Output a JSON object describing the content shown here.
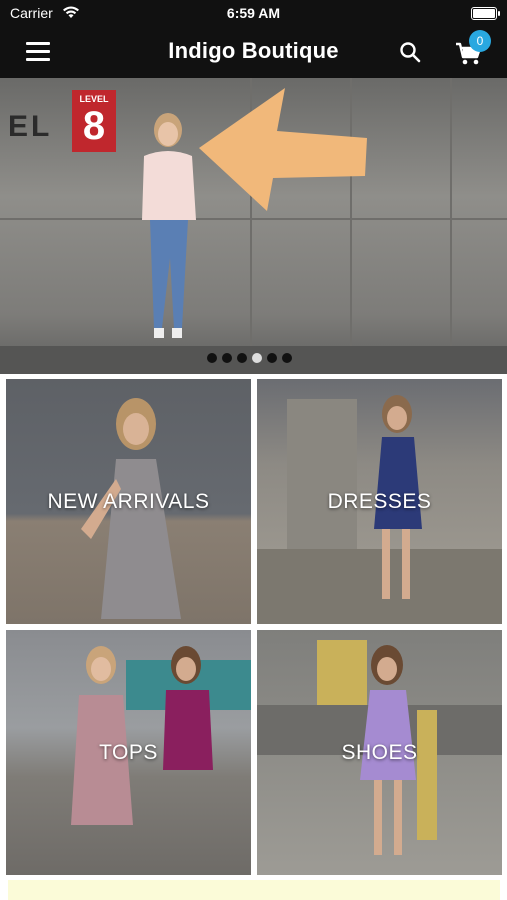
{
  "status": {
    "carrier": "Carrier",
    "time": "6:59 AM"
  },
  "nav": {
    "title": "Indigo Boutique",
    "cart_count": "0"
  },
  "hero": {
    "sign_level": "LEVEL",
    "sign_number": "8",
    "wall_text": "EL",
    "slides": 6,
    "active_slide": 4
  },
  "categories": [
    {
      "label": "NEW ARRIVALS"
    },
    {
      "label": "DRESSES"
    },
    {
      "label": "TOPS"
    },
    {
      "label": "SHOES"
    }
  ],
  "colors": {
    "bar": "#111111",
    "badge": "#29a8e0",
    "sign": "#c0272d",
    "banner": "#fbfbd8"
  },
  "icons": [
    "wifi-icon",
    "battery-icon",
    "menu-icon",
    "search-icon",
    "cart-icon"
  ]
}
